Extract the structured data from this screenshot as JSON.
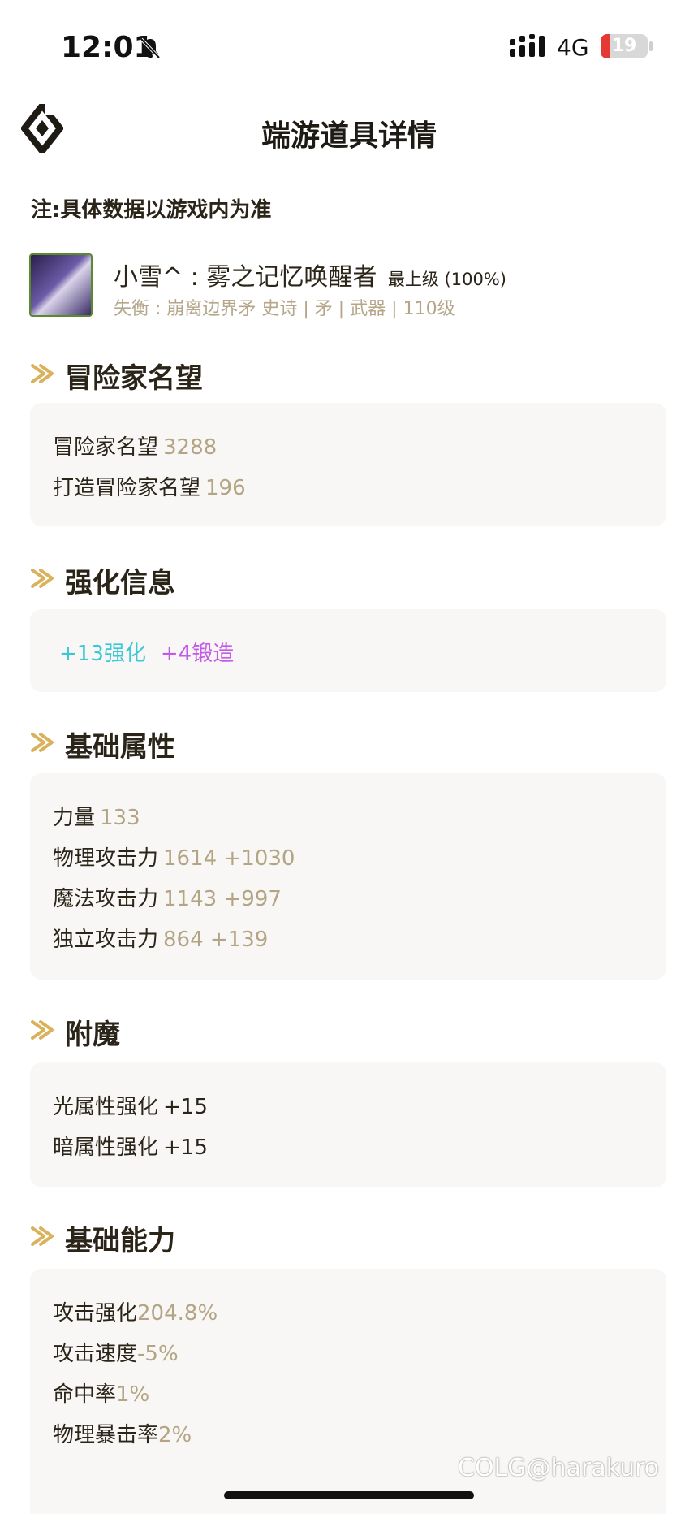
{
  "status": {
    "time": "12:01",
    "network": "4G",
    "battery": "19",
    "battery_level": 0.19
  },
  "nav": {
    "title": "端游道具详情"
  },
  "note": "注:具体数据以游戏内为准",
  "item": {
    "name": "小雪^ : 雾之记忆唤醒者",
    "grade": "最上级 (100%)",
    "meta": "失衡 : 崩离边界矛  史诗  | 矛  | 武器  | 110级"
  },
  "sections": {
    "reputation": {
      "title": "冒险家名望",
      "rows": [
        {
          "label": "冒险家名望",
          "value": "3288"
        },
        {
          "label": "打造冒险家名望",
          "value": "196"
        }
      ]
    },
    "enhance": {
      "title": "强化信息",
      "refine": "+13强化",
      "forge": "+4锻造"
    },
    "base_attr": {
      "title": "基础属性",
      "rows": [
        {
          "label": "力量",
          "value": "133"
        },
        {
          "label": "物理攻击力",
          "value": "1614 +1030"
        },
        {
          "label": "魔法攻击力",
          "value": "1143 +997"
        },
        {
          "label": "独立攻击力",
          "value": "864 +139"
        }
      ]
    },
    "enchant": {
      "title": "附魔",
      "rows": [
        {
          "label": "光属性强化",
          "value": "+15"
        },
        {
          "label": "暗属性强化",
          "value": "+15"
        }
      ]
    },
    "base_ability": {
      "title": "基础能力",
      "rows": [
        {
          "label": "攻击强化",
          "value": "204.8%"
        },
        {
          "label": "攻击速度",
          "value": "-5%"
        },
        {
          "label": "命中率",
          "value": "1%"
        },
        {
          "label": "物理暴击率",
          "value": "2%"
        }
      ]
    }
  },
  "watermark": "COLG@harakuro",
  "colors": {
    "accent_gold": "#d8b25c",
    "value_tan": "#b3a483",
    "refine_cyan": "#39c9d6",
    "forge_purple": "#c45ae8",
    "card_bg": "#f8f7f5"
  }
}
